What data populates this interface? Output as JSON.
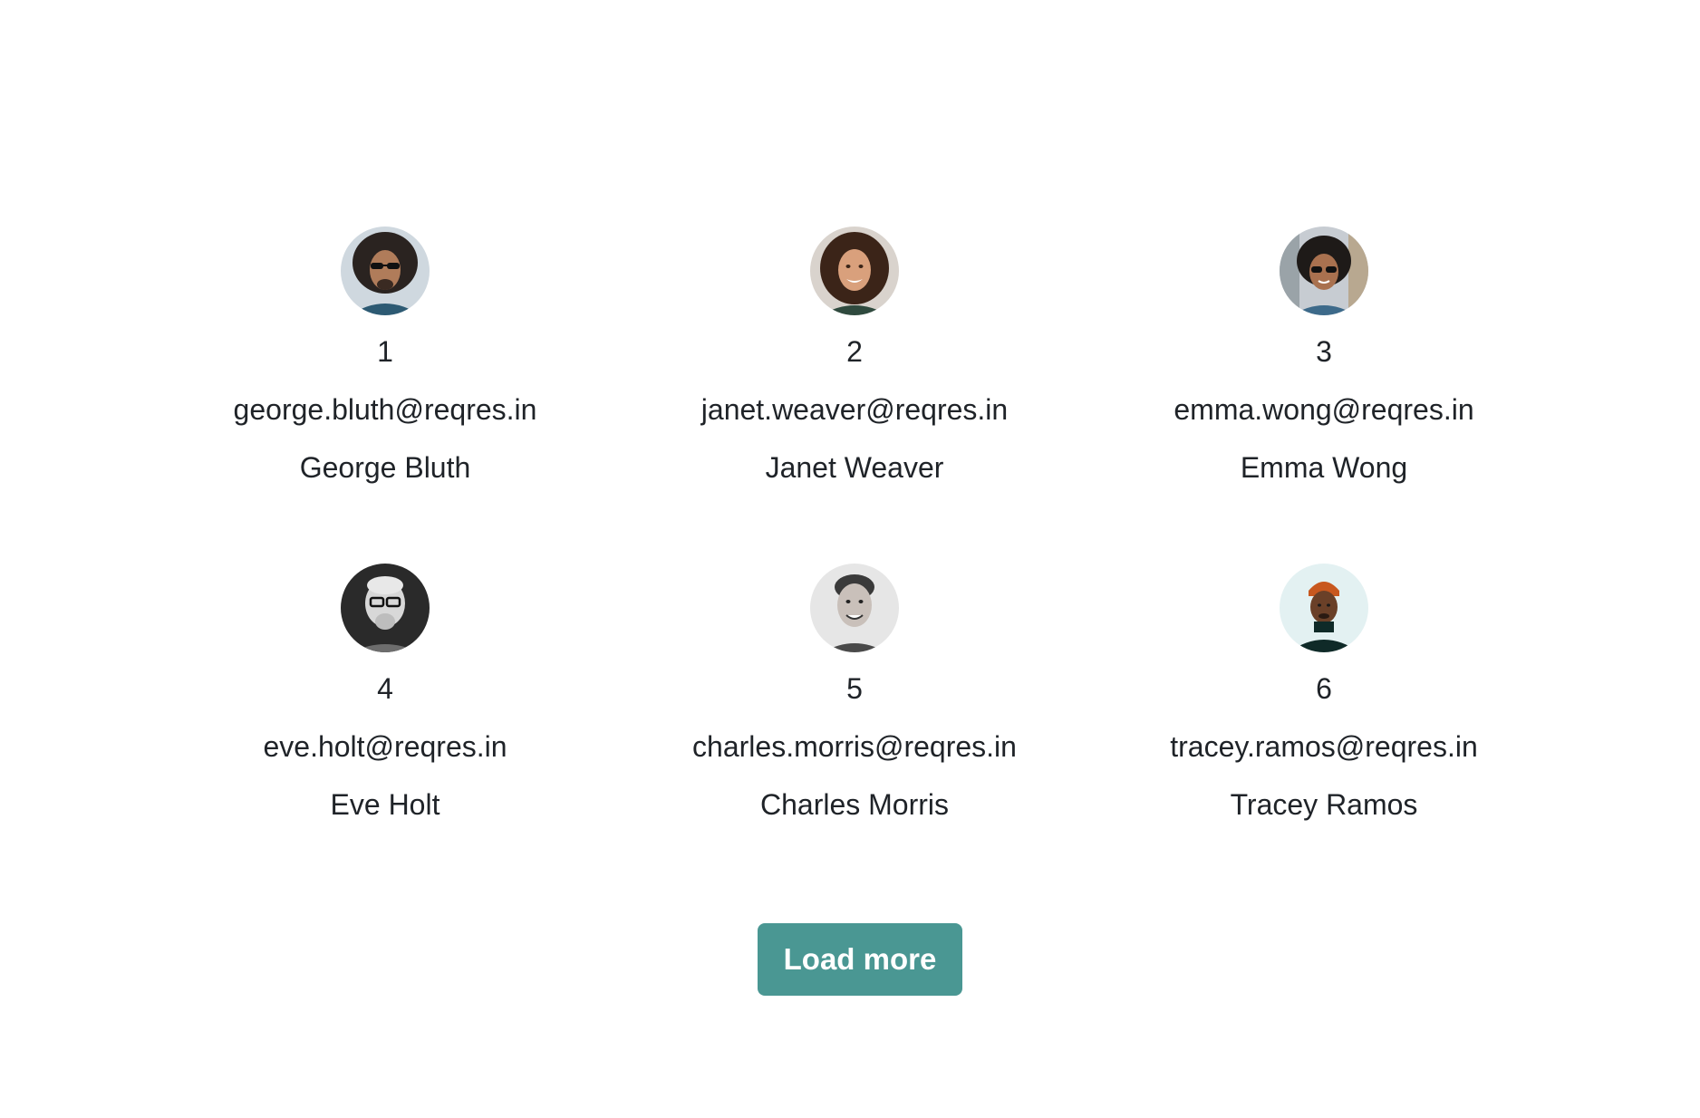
{
  "users": [
    {
      "id": "1",
      "email": "george.bluth@reqres.in",
      "name": "George Bluth",
      "avatar_icon": "george-avatar-icon"
    },
    {
      "id": "2",
      "email": "janet.weaver@reqres.in",
      "name": "Janet Weaver",
      "avatar_icon": "janet-avatar-icon"
    },
    {
      "id": "3",
      "email": "emma.wong@reqres.in",
      "name": "Emma Wong",
      "avatar_icon": "emma-avatar-icon"
    },
    {
      "id": "4",
      "email": "eve.holt@reqres.in",
      "name": "Eve Holt",
      "avatar_icon": "eve-avatar-icon"
    },
    {
      "id": "5",
      "email": "charles.morris@reqres.in",
      "name": "Charles Morris",
      "avatar_icon": "charles-avatar-icon"
    },
    {
      "id": "6",
      "email": "tracey.ramos@reqres.in",
      "name": "Tracey Ramos",
      "avatar_icon": "tracey-avatar-icon"
    }
  ],
  "load_more_label": "Load more",
  "colors": {
    "button": "#4a9793",
    "text": "#1f2328",
    "background": "#ffffff"
  }
}
